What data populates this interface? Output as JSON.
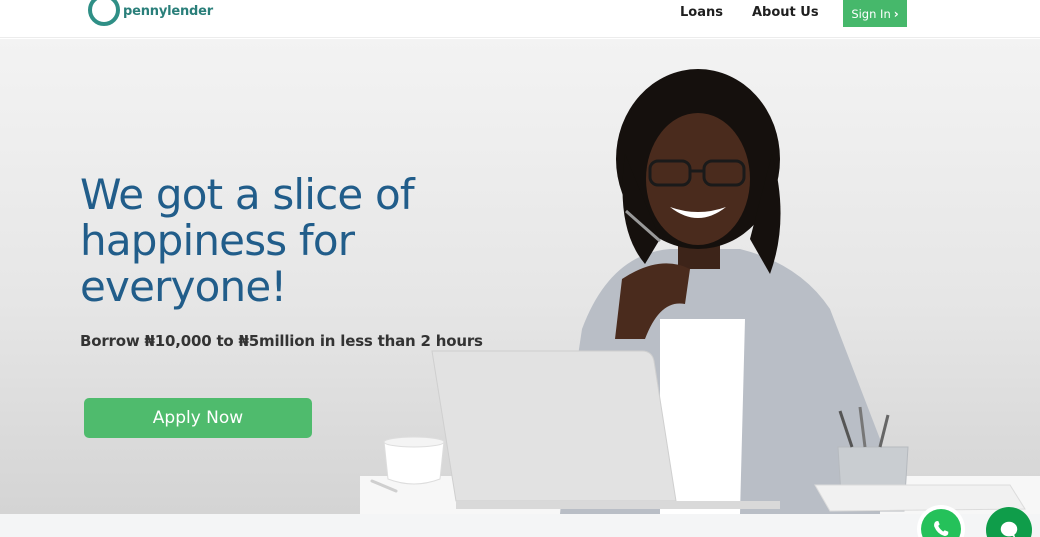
{
  "header": {
    "logo_text": "pennylender",
    "nav": {
      "loans": "Loans",
      "about": "About Us"
    },
    "signin_label": "Sign In"
  },
  "hero": {
    "title": "We got a slice of happiness for everyone!",
    "subtitle": "Borrow ₦10,000 to ₦5million in less than 2 hours",
    "cta_label": "Apply Now"
  },
  "floating": {
    "whatsapp_icon": "whatsapp-icon",
    "chat_icon": "chat-bubble-icon"
  },
  "colors": {
    "brand_teal": "#2f8f86",
    "title_blue": "#215d8a",
    "green": "#4fbb6d",
    "whatsapp_green": "#25c15a",
    "chat_green": "#0f9d4a"
  }
}
